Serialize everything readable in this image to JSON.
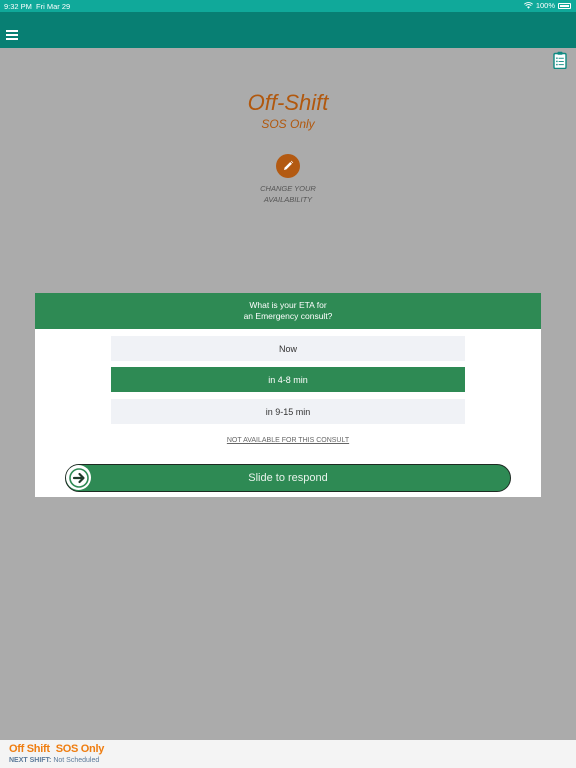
{
  "status_bar": {
    "time": "9:32 PM",
    "date": "Fri Mar 29",
    "battery": "100%"
  },
  "nav": {
    "menu_icon": "hamburger-icon"
  },
  "toolbar": {
    "clipboard_icon": "clipboard-list-icon"
  },
  "availability": {
    "status": "Off-Shift",
    "mode": "SOS Only",
    "change_label_line1": "CHANGE YOUR",
    "change_label_line2": "AVAILABILITY",
    "edit_icon": "pencil-icon"
  },
  "dialog": {
    "title_line1": "What is your ETA for",
    "title_line2": "an Emergency consult?",
    "options": [
      "Now",
      "in 4-8 min",
      "in 9-15 min"
    ],
    "selected_option": "in 4-8 min",
    "not_available": "NOT AVAILABLE FOR THIS CONSULT",
    "slider_label": "Slide to respond",
    "slider_icon": "arrow-right-icon"
  },
  "footer": {
    "status": "Off Shift",
    "mode": "SOS Only",
    "next_shift_label": "NEXT SHIFT:",
    "next_shift_value": "Not Scheduled"
  },
  "colors": {
    "status_bar": "#10a99a",
    "nav_bar": "#087f73",
    "accent_orange": "#b1580e",
    "dialog_green": "#2e8a54",
    "footer_orange": "#ef7d10"
  }
}
